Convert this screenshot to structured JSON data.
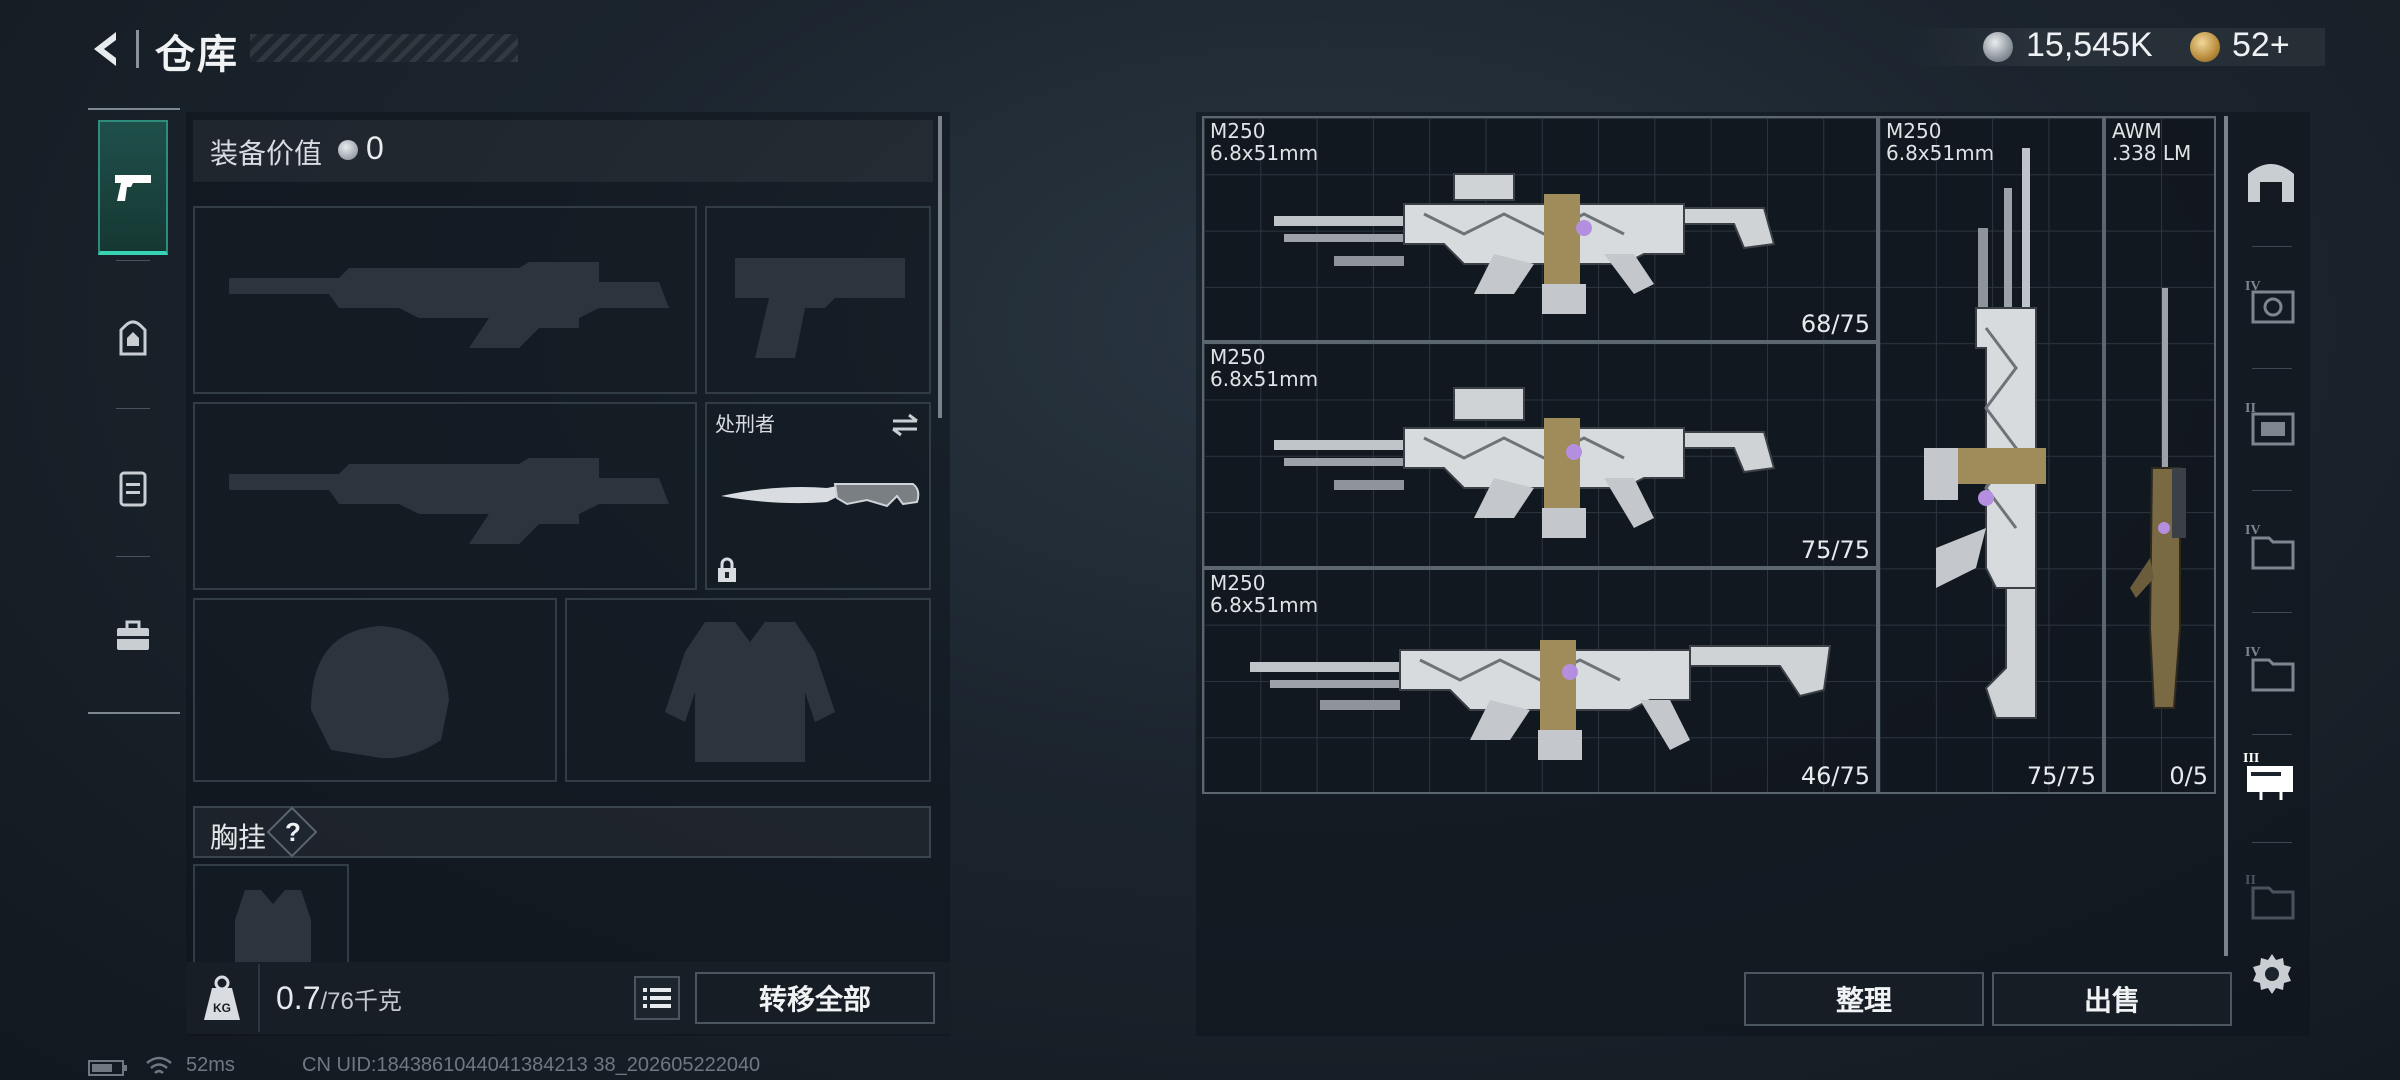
{
  "header": {
    "title": "仓库",
    "currency_silver": "15,545K",
    "currency_gold": "52+"
  },
  "equipment": {
    "value_label": "装备价值",
    "value": "0",
    "melee_name": "处刑者",
    "chest_label": "胸挂",
    "help_symbol": "?"
  },
  "weight": {
    "current": "0.7",
    "capacity": "/76千克"
  },
  "actions": {
    "transfer_all": "转移全部",
    "organize": "整理",
    "sell": "出售"
  },
  "warehouse_items": [
    {
      "name": "M250",
      "caliber": "6.8x51mm",
      "count": "68/75"
    },
    {
      "name": "M250",
      "caliber": "6.8x51mm",
      "count": "75/75"
    },
    {
      "name": "M250",
      "caliber": "6.8x51mm",
      "count": "46/75"
    },
    {
      "name": "M250",
      "caliber": "6.8x51mm",
      "count": "75/75"
    },
    {
      "name": "AWM",
      "caliber": ".338 LM",
      "count": "0/5"
    }
  ],
  "right_tabs": [
    "IV",
    "II",
    "IV",
    "IV",
    "III",
    "II"
  ],
  "status": {
    "ping": "52ms",
    "uid": "CN UID:1843861044041384213 38_202605222040"
  },
  "colors": {
    "accent_teal": "#37d3b5",
    "background": "#1b242d"
  }
}
